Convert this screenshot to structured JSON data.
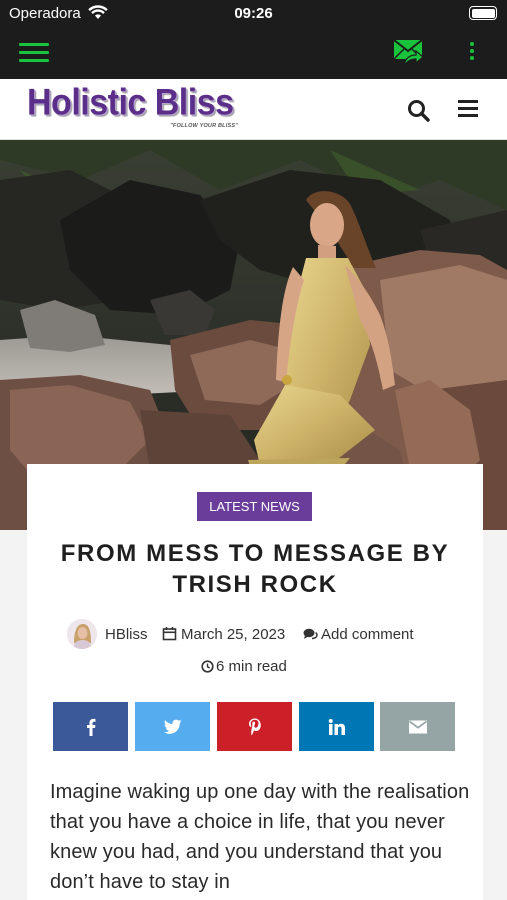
{
  "status_bar": {
    "carrier": "Operadora",
    "time": "09:26",
    "wifi_icon": "wifi-icon",
    "battery_icon": "battery-icon"
  },
  "app_bar": {
    "menu_icon": "hamburger-menu-icon",
    "mail_icon": "mail-forward-icon",
    "more_icon": "more-vertical-icon",
    "accent_color": "#19c33c",
    "background": "#1c1c1c"
  },
  "site": {
    "logo_text": "Holistic Bliss",
    "tagline": "\"FOLLOW YOUR BLISS\"",
    "brand_color": "#5b2e8a",
    "search_icon": "search-icon",
    "nav_icon": "menu-icon"
  },
  "hero": {
    "image": "woman-in-gold-dress-on-rocks-photo"
  },
  "article": {
    "category": "LATEST NEWS",
    "category_color": "#6a3d9a",
    "title": "FROM MESS TO MESSAGE BY TRISH ROCK",
    "author": "HBliss",
    "date": "March 25, 2023",
    "comment_label": "Add comment",
    "read_time": "6 min read",
    "body": "Imagine waking up one day with the realisation that you have a choice in life, that you never knew you had, and you understand that you don’t have to stay in"
  },
  "share": [
    {
      "network": "facebook",
      "icon": "facebook-icon",
      "color": "#3b5998"
    },
    {
      "network": "twitter",
      "icon": "twitter-icon",
      "color": "#55acee"
    },
    {
      "network": "pinterest",
      "icon": "pinterest-icon",
      "color": "#cb2027"
    },
    {
      "network": "linkedin",
      "icon": "linkedin-icon",
      "color": "#0077b5"
    },
    {
      "network": "email",
      "icon": "email-icon",
      "color": "#95a5a6"
    }
  ]
}
